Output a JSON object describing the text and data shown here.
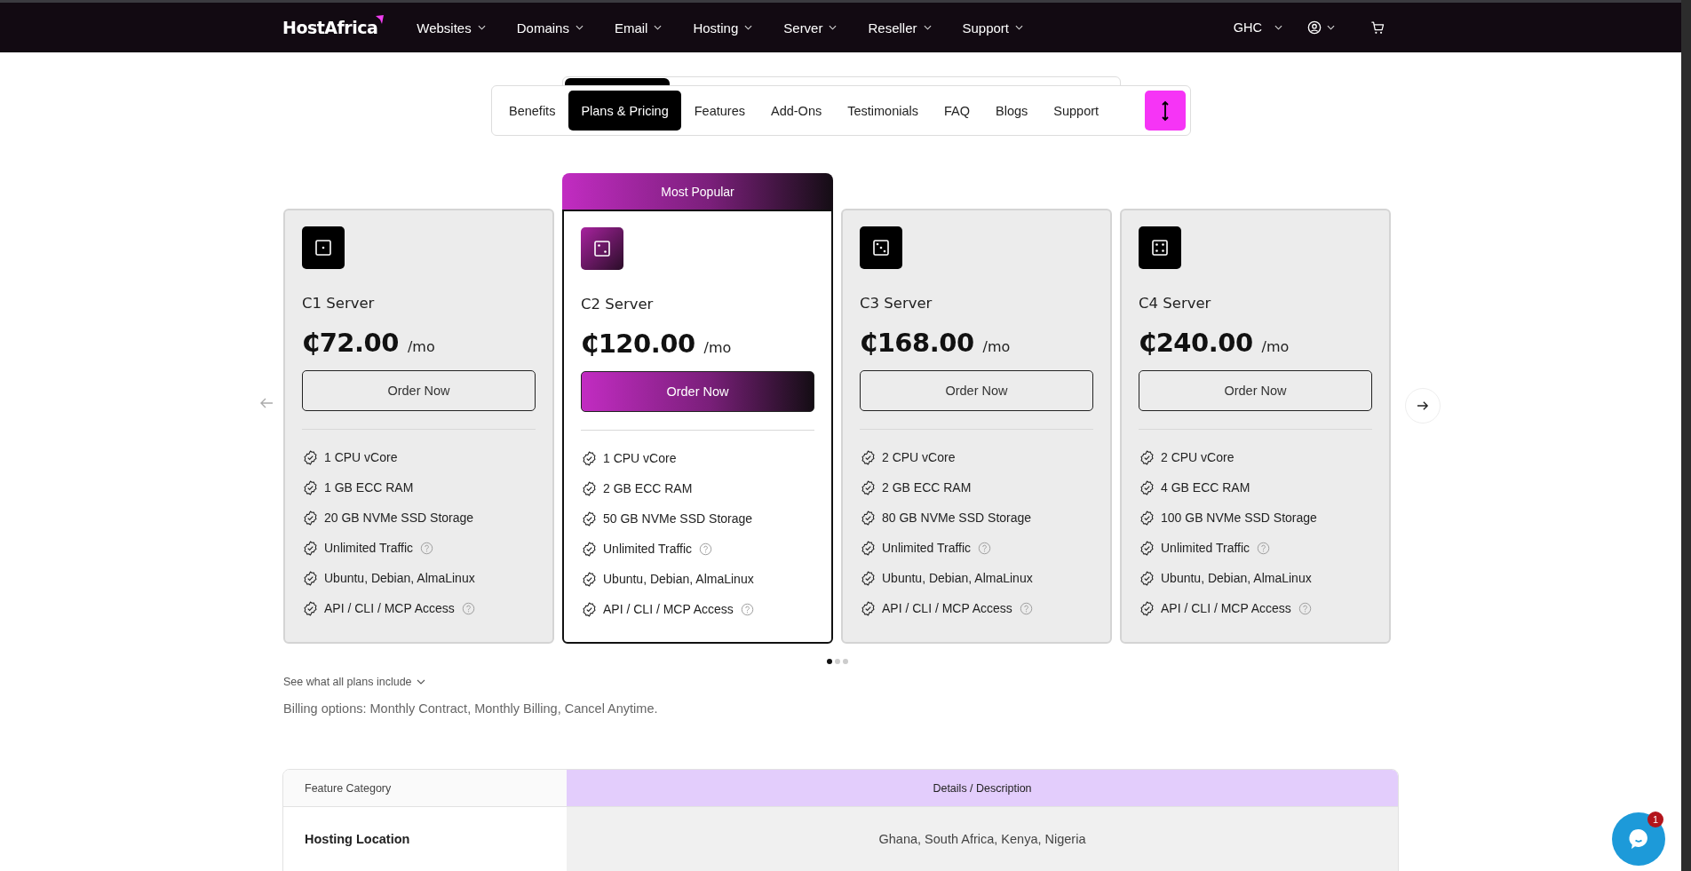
{
  "nav": {
    "logo": "HostAfrica",
    "items": [
      {
        "label": "Websites"
      },
      {
        "label": "Domains"
      },
      {
        "label": "Email"
      },
      {
        "label": "Hosting"
      },
      {
        "label": "Server"
      },
      {
        "label": "Reseller"
      },
      {
        "label": "Support"
      }
    ],
    "currency": "GHC"
  },
  "section_tabs": [
    {
      "label": "Benefits",
      "selected": false
    },
    {
      "label": "Plans & Pricing",
      "selected": true
    },
    {
      "label": "Features",
      "selected": false
    },
    {
      "label": "Add-Ons",
      "selected": false
    },
    {
      "label": "Testimonials",
      "selected": false
    },
    {
      "label": "FAQ",
      "selected": false
    },
    {
      "label": "Blogs",
      "selected": false
    },
    {
      "label": "Support",
      "selected": false
    }
  ],
  "plans": [
    {
      "name": "C1 Server",
      "price": "₵72.00",
      "period": "/mo",
      "button": "Order Now",
      "featured": false,
      "features": [
        {
          "text": "1 CPU vCore",
          "info": false
        },
        {
          "text": "1 GB ECC RAM",
          "info": false
        },
        {
          "text": "20 GB NVMe SSD Storage",
          "info": false
        },
        {
          "text": "Unlimited Traffic",
          "info": true
        },
        {
          "text": "Ubuntu, Debian, AlmaLinux",
          "info": false
        },
        {
          "text": "API / CLI / MCP Access",
          "info": true
        }
      ]
    },
    {
      "name": "C2 Server",
      "price": "₵120.00",
      "period": "/mo",
      "button": "Order Now",
      "featured": true,
      "badge": "Most Popular",
      "features": [
        {
          "text": "1 CPU vCore",
          "info": false
        },
        {
          "text": "2 GB ECC RAM",
          "info": false
        },
        {
          "text": "50 GB NVMe SSD Storage",
          "info": false
        },
        {
          "text": "Unlimited Traffic",
          "info": true
        },
        {
          "text": "Ubuntu, Debian, AlmaLinux",
          "info": false
        },
        {
          "text": "API / CLI / MCP Access",
          "info": true
        }
      ]
    },
    {
      "name": "C3 Server",
      "price": "₵168.00",
      "period": "/mo",
      "button": "Order Now",
      "featured": false,
      "features": [
        {
          "text": "2 CPU vCore",
          "info": false
        },
        {
          "text": "2 GB ECC RAM",
          "info": false
        },
        {
          "text": "80 GB NVMe SSD Storage",
          "info": false
        },
        {
          "text": "Unlimited Traffic",
          "info": true
        },
        {
          "text": "Ubuntu, Debian, AlmaLinux",
          "info": false
        },
        {
          "text": "API / CLI / MCP Access",
          "info": true
        }
      ]
    },
    {
      "name": "C4 Server",
      "price": "₵240.00",
      "period": "/mo",
      "button": "Order Now",
      "featured": false,
      "features": [
        {
          "text": "2 CPU vCore",
          "info": false
        },
        {
          "text": "4 GB ECC RAM",
          "info": false
        },
        {
          "text": "100 GB NVMe SSD Storage",
          "info": false
        },
        {
          "text": "Unlimited Traffic",
          "info": true
        },
        {
          "text": "Ubuntu, Debian, AlmaLinux",
          "info": false
        },
        {
          "text": "API / CLI / MCP Access",
          "info": true
        }
      ]
    }
  ],
  "carousel_dots": [
    {
      "selected": true
    },
    {
      "selected": false
    },
    {
      "selected": false
    }
  ],
  "plans_toggle": "See what all plans include",
  "billing_note": "Billing options: Monthly Contract, Monthly Billing, Cancel Anytime.",
  "table": {
    "columns": [
      "Feature Category",
      "Details / Description"
    ],
    "rows": [
      [
        "Hosting Location",
        "Ghana, South Africa, Kenya, Nigeria"
      ]
    ]
  },
  "chat": {
    "badge": "1"
  }
}
